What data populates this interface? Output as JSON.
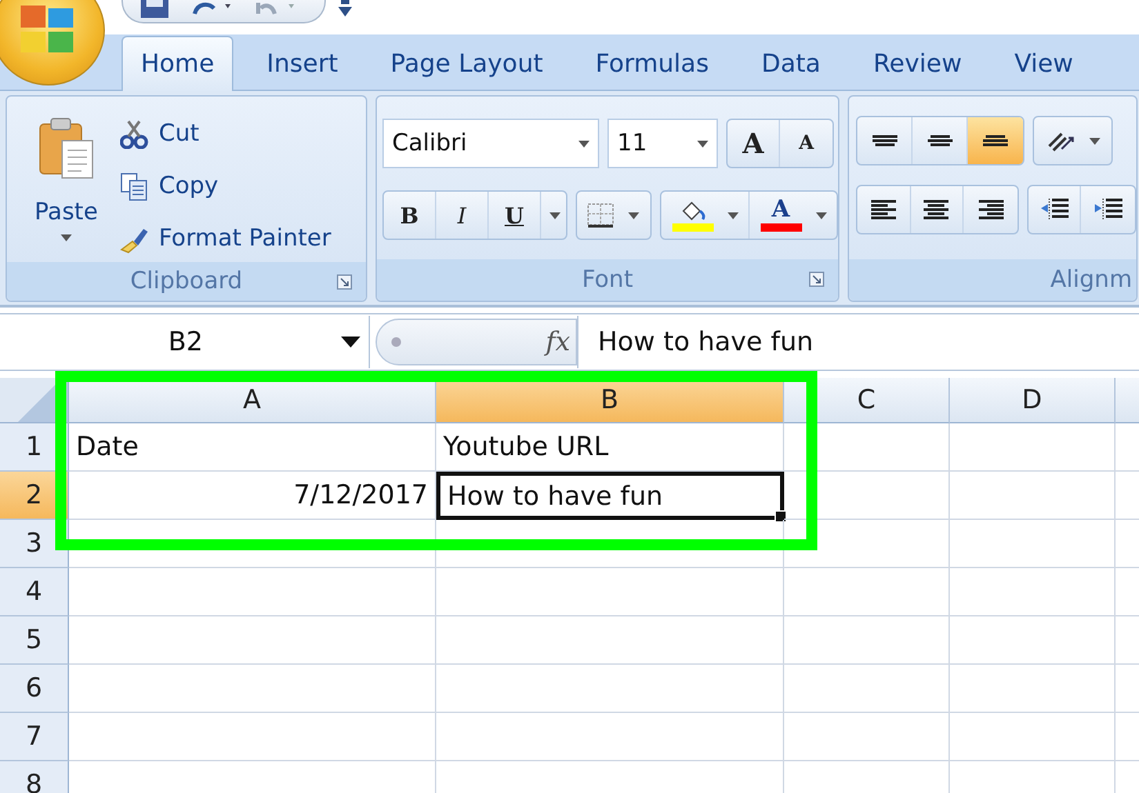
{
  "tabs": [
    {
      "label": "Home",
      "selected": true
    },
    {
      "label": "Insert",
      "selected": false
    },
    {
      "label": "Page Layout",
      "selected": false
    },
    {
      "label": "Formulas",
      "selected": false
    },
    {
      "label": "Data",
      "selected": false
    },
    {
      "label": "Review",
      "selected": false
    },
    {
      "label": "View",
      "selected": false
    }
  ],
  "clipboard": {
    "title": "Clipboard",
    "paste": "Paste",
    "items": [
      {
        "kind": "cut",
        "label": "Cut"
      },
      {
        "kind": "copy",
        "label": "Copy"
      },
      {
        "kind": "painter",
        "label": "Format Painter"
      }
    ]
  },
  "font": {
    "title": "Font",
    "font_name": "Calibri",
    "font_size": "11",
    "size_buttons": [
      {
        "label": "A",
        "kind": "grow"
      },
      {
        "label": "A",
        "kind": "shrink"
      }
    ],
    "style_buttons": [
      {
        "label": "B",
        "kind": "bold"
      },
      {
        "label": "I",
        "kind": "italic"
      },
      {
        "label": "U",
        "kind": "underline"
      }
    ],
    "color_buttons": [
      {
        "kind": "fill",
        "color": "#ffff00"
      },
      {
        "kind": "text",
        "label": "A",
        "color": "#ff0000"
      }
    ]
  },
  "alignment": {
    "title": "Alignm",
    "vertical": [
      {
        "kind": "top",
        "selected": false
      },
      {
        "kind": "middle",
        "selected": false
      },
      {
        "kind": "bottom",
        "selected": true
      }
    ],
    "horizontal": [
      {
        "kind": "left"
      },
      {
        "kind": "center"
      },
      {
        "kind": "right"
      }
    ]
  },
  "formula_bar": {
    "name_box": "B2",
    "function_label": "fx",
    "value": "How to have fun"
  },
  "sheet": {
    "columns": [
      {
        "label": "A",
        "selected": false
      },
      {
        "label": "B",
        "selected": true
      },
      {
        "label": "C",
        "selected": false
      },
      {
        "label": "D",
        "selected": false
      }
    ],
    "rows": [
      {
        "label": "1",
        "selected": false,
        "cells": [
          {
            "text": "Date",
            "kind": "text"
          },
          {
            "text": "Youtube URL",
            "kind": "text",
            "active": false
          }
        ]
      },
      {
        "label": "2",
        "selected": true,
        "cells": [
          {
            "text": "7/12/2017",
            "kind": "number"
          },
          {
            "text": "How to have fun",
            "kind": "text",
            "active": true
          }
        ]
      },
      {
        "label": "3",
        "selected": false
      },
      {
        "label": "4",
        "selected": false
      },
      {
        "label": "5",
        "selected": false
      },
      {
        "label": "6",
        "selected": false
      },
      {
        "label": "7",
        "selected": false
      },
      {
        "label": "8",
        "selected": false
      }
    ]
  },
  "annotation": {
    "kind": "highlight-box"
  }
}
